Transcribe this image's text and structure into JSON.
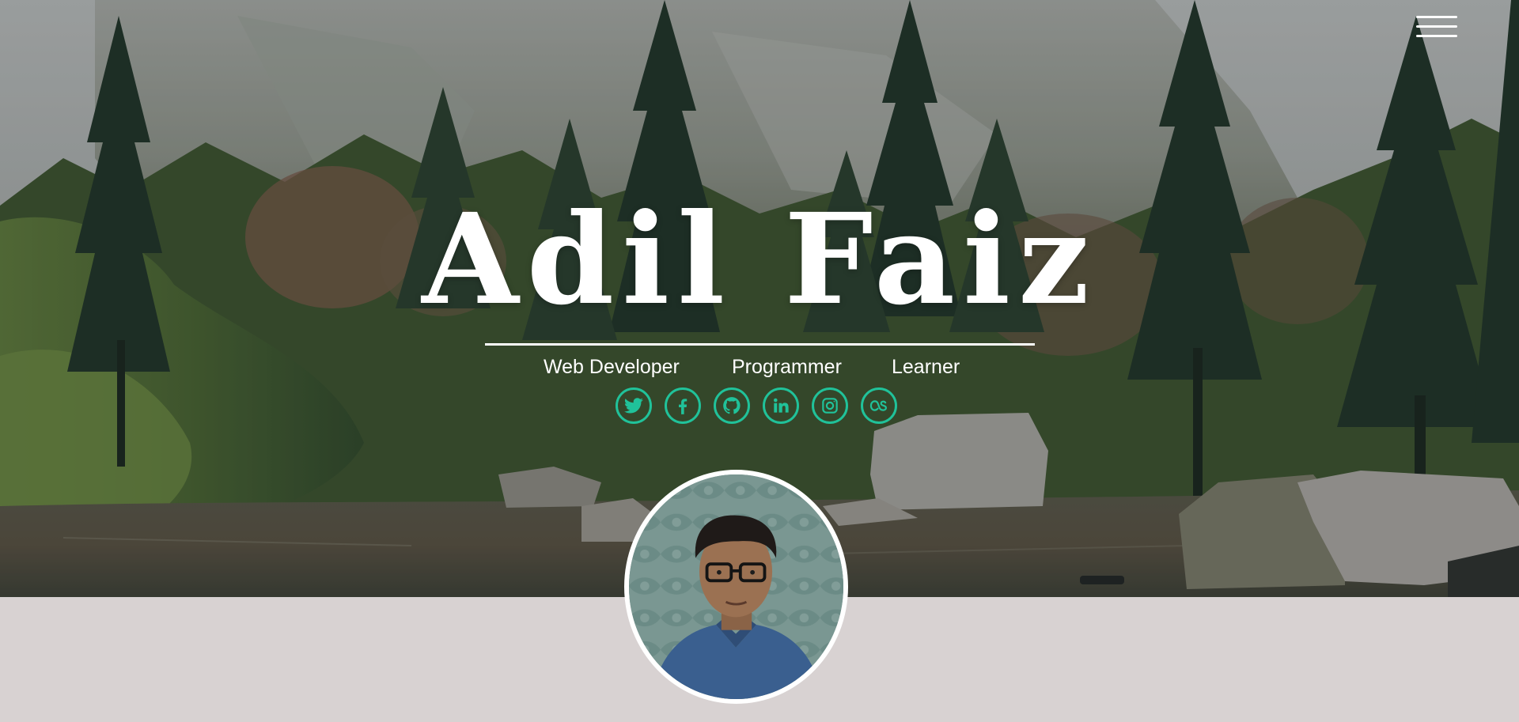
{
  "hero": {
    "name": "Adil Faiz",
    "roles": [
      "Web Developer",
      "Programmer",
      "Learner"
    ],
    "background_scene": "mountain-lake-forest"
  },
  "menu": {
    "icon": "hamburger-menu-icon"
  },
  "social_links": [
    {
      "icon": "twitter-icon"
    },
    {
      "icon": "facebook-icon"
    },
    {
      "icon": "github-icon"
    },
    {
      "icon": "linkedin-icon"
    },
    {
      "icon": "instagram-icon"
    },
    {
      "icon": "lastfm-icon"
    }
  ],
  "profile": {
    "image": "avatar"
  },
  "colors": {
    "accent": "#20c29a",
    "page_background": "#d8d2d2",
    "text_light": "#ffffff"
  }
}
